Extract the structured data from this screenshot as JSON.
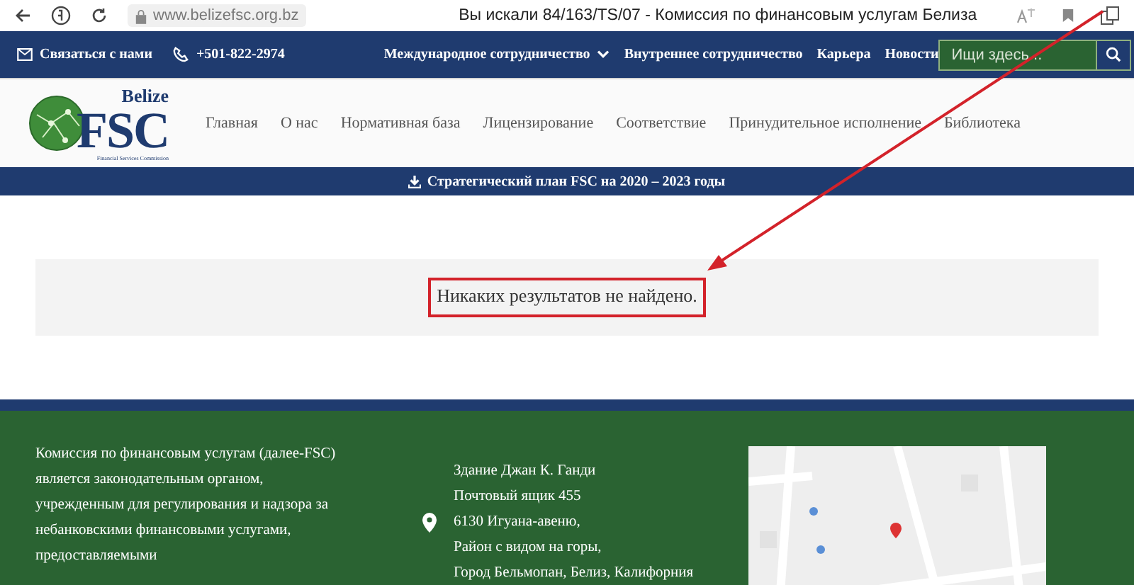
{
  "browser": {
    "address": "www.belizefsc.org.bz",
    "title": "Вы искали 84/163/TS/07 - Комиссия по финансовым услугам Белиза"
  },
  "top_bar": {
    "contact": "Связаться с нами",
    "phone": "+501-822-2974",
    "links": [
      {
        "label": "Международное сотрудничество",
        "kind": "dropdown"
      },
      {
        "label": "Внутреннее сотрудничество",
        "kind": "link"
      },
      {
        "label": "Карьера",
        "kind": "link"
      },
      {
        "label": "Новости",
        "kind": "link"
      }
    ],
    "search": {
      "placeholder": "Ищи здесь..."
    }
  },
  "logo": {
    "top": "Belize",
    "main": "FSC",
    "sub": "Financial Services Commission"
  },
  "nav": [
    "Главная",
    "О нас",
    "Нормативная база",
    "Лицензирование",
    "Соответствие",
    "Принудительное исполнение",
    "Библиотека"
  ],
  "banner": "Стратегический план FSC на 2020 – 2023 годы",
  "result": {
    "message": "Никаких результатов не найдено."
  },
  "footer": {
    "about": "Комиссия по финансовым услугам (далее-FSC) является законодательным органом, учрежденным для регулирования и надзора за небанковскими финансовыми услугами, предоставляемыми",
    "address": [
      "Здание Джан К. Ганди",
      "Почтовый ящик 455",
      "6130 Игуана-авеню,",
      "Район с видом на горы,",
      "Город Бельмопан, Белиз, Калифорния"
    ]
  }
}
